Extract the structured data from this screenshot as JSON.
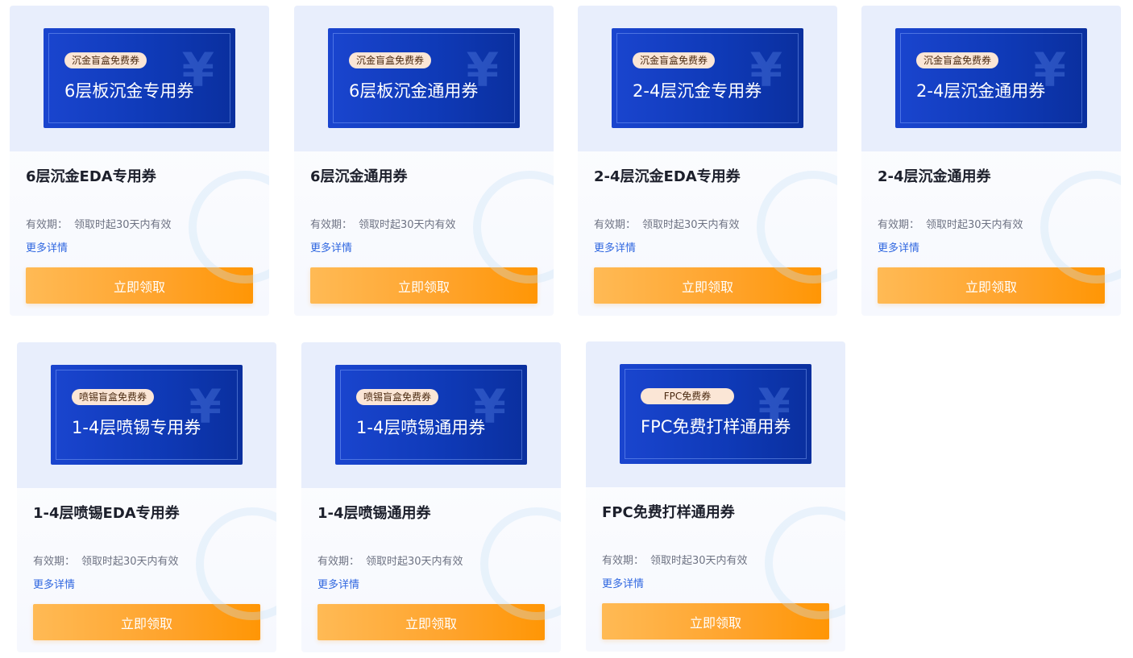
{
  "yen_symbol": "¥",
  "validity_label": "有效期：",
  "validity_text": "领取时起30天内有效",
  "more_label": "更多详情",
  "button_label": "立即领取",
  "cards": [
    {
      "badge": "沉金盲盒免费券",
      "ticket_title": "6层板沉金专用券",
      "title": "6层沉金EDA专用券"
    },
    {
      "badge": "沉金盲盒免费券",
      "ticket_title": "6层板沉金通用券",
      "title": "6层沉金通用券"
    },
    {
      "badge": "沉金盲盒免费券",
      "ticket_title": "2-4层沉金专用券",
      "title": "2-4层沉金EDA专用券"
    },
    {
      "badge": "沉金盲盒免费券",
      "ticket_title": "2-4层沉金通用券",
      "title": "2-4层沉金通用券"
    },
    {
      "badge": "喷锡盲盒免费券",
      "ticket_title": "1-4层喷锡专用券",
      "title": "1-4层喷锡EDA专用券"
    },
    {
      "badge": "喷锡盲盒免费券",
      "ticket_title": "1-4层喷锡通用券",
      "title": "1-4层喷锡通用券"
    },
    {
      "badge": "FPC免费券",
      "ticket_title": "FPC免费打样通用券",
      "title": "FPC免费打样通用券"
    }
  ],
  "colors": {
    "ticket_blue": "#1a45cf",
    "button_orange": "#ffa32b",
    "link_blue": "#2f67e0",
    "badge_bg": "#fbe6d6"
  }
}
